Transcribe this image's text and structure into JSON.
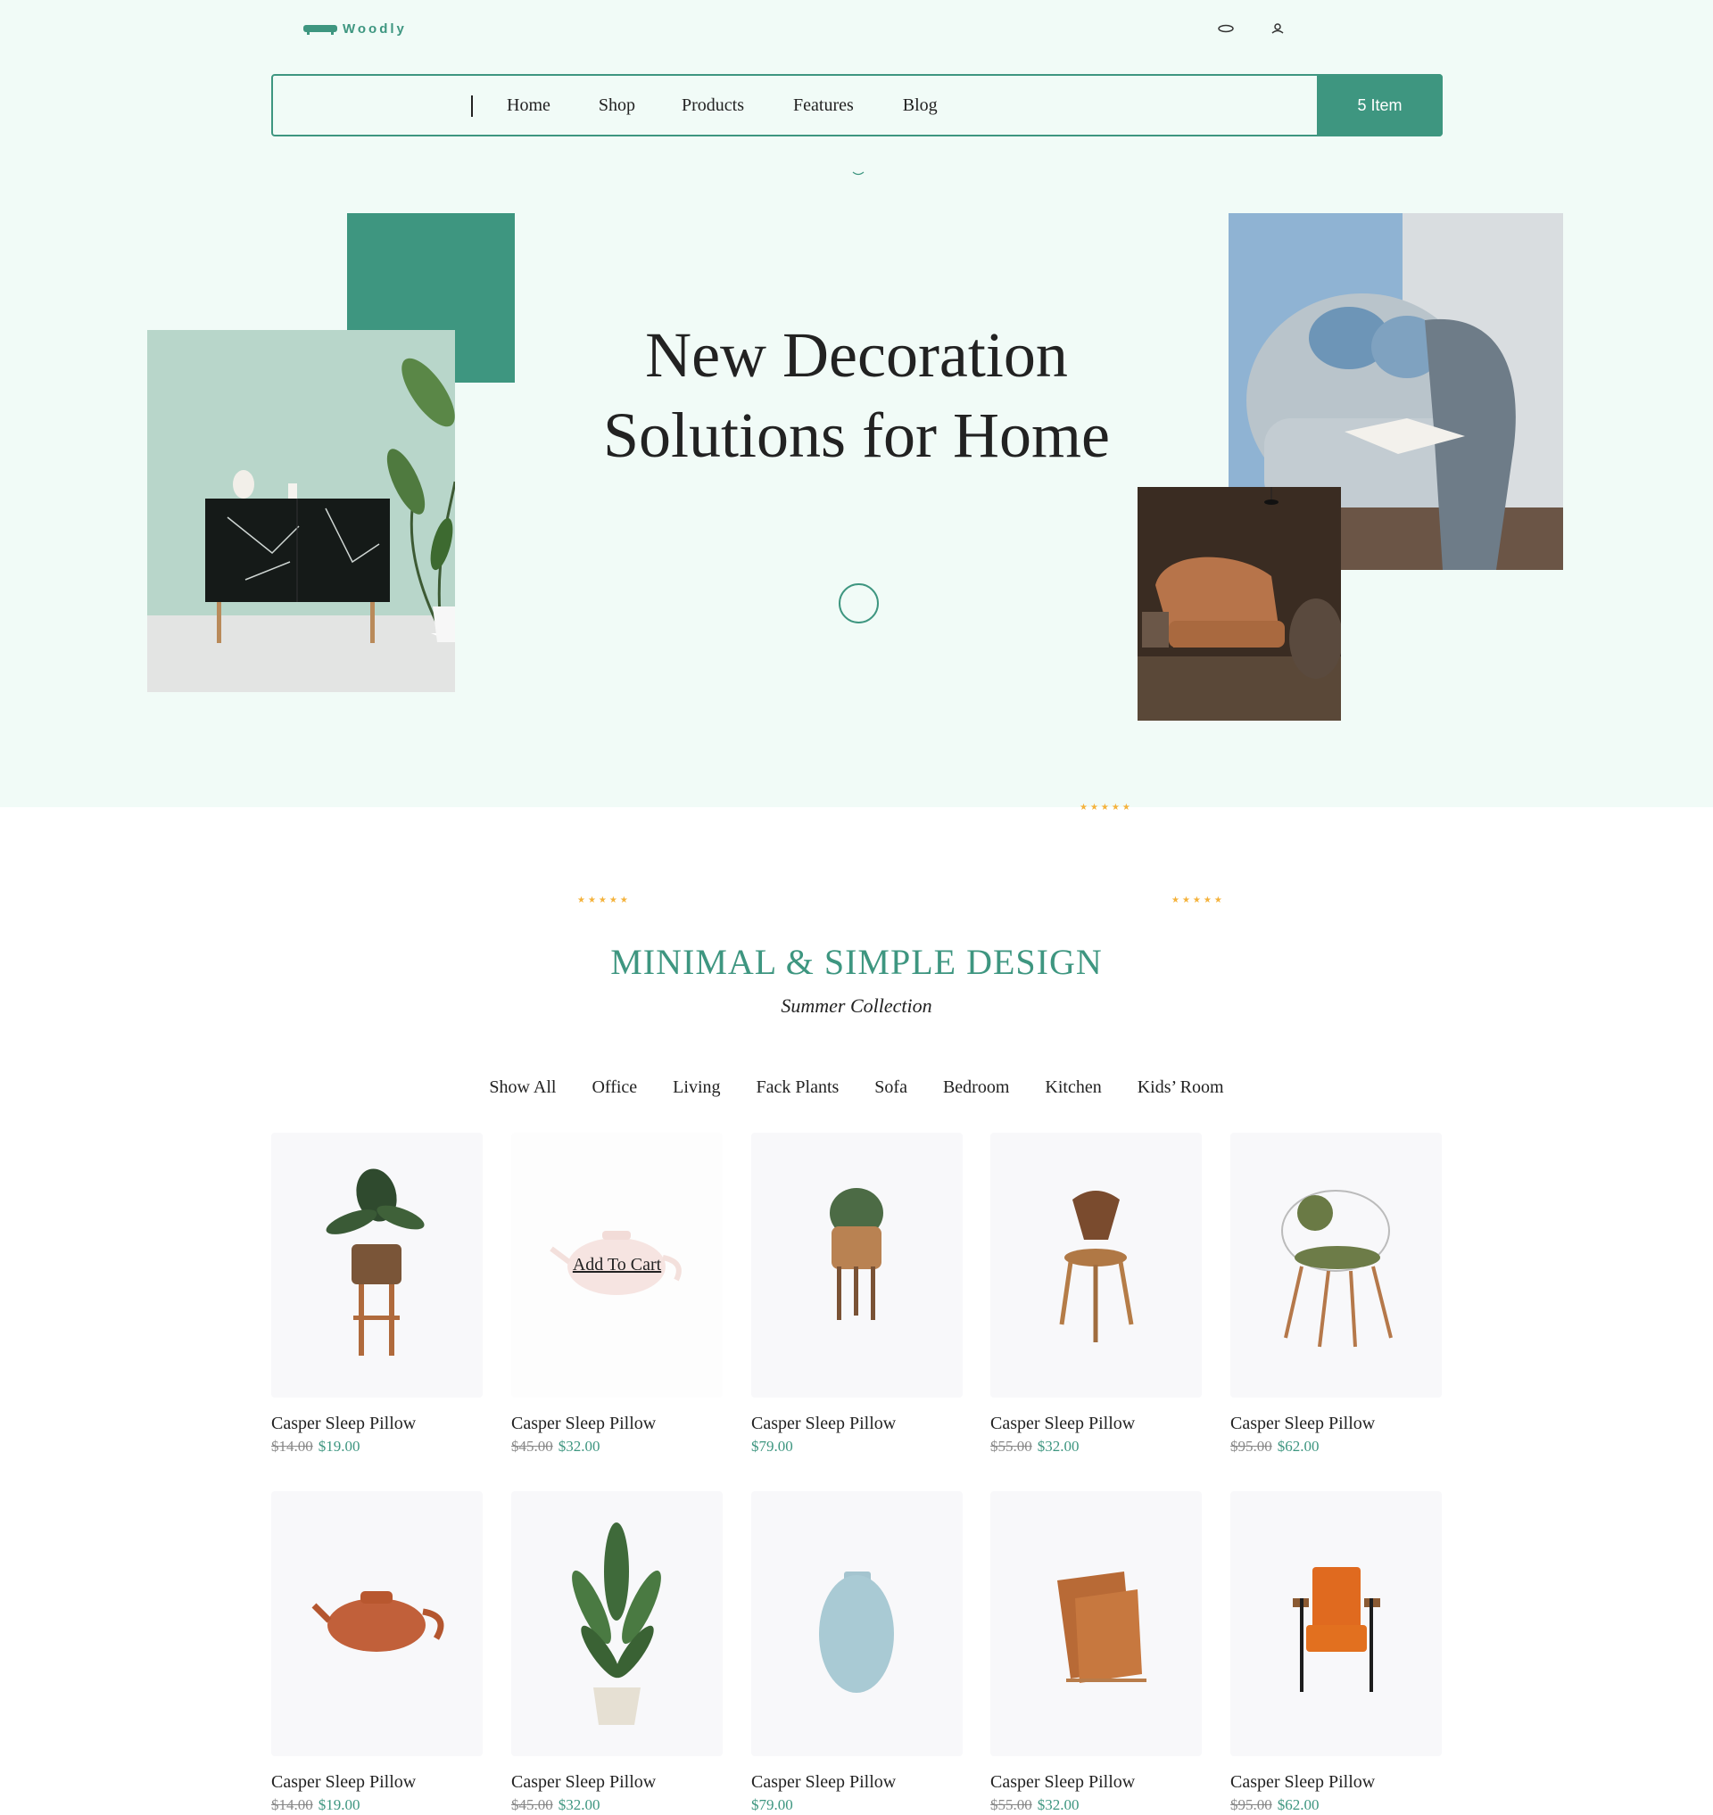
{
  "brand": {
    "name": "Woodly"
  },
  "icons": {
    "search": "search-icon",
    "user": "user-icon",
    "logo": "sofa-icon"
  },
  "nav": {
    "items": [
      "Home",
      "Shop",
      "Products",
      "Features",
      "Blog"
    ],
    "cart_label": "5 Item"
  },
  "hero": {
    "title_line1": "New Decoration",
    "title_line2": "Solutions for Home"
  },
  "section": {
    "title": "MINIMAL & SIMPLE DESIGN",
    "subtitle": "Summer Collection",
    "stars": "★★★★★"
  },
  "filters": [
    "Show All",
    "Office",
    "Living",
    "Fack Plants",
    "Sofa",
    "Bedroom",
    "Kitchen",
    "Kids’ Room"
  ],
  "products": [
    {
      "name": "Casper Sleep Pillow",
      "old_price": "$14.00",
      "price": "$19.00",
      "image": "plant-stand"
    },
    {
      "name": "Casper Sleep Pillow",
      "old_price": "$45.00",
      "price": "$32.00",
      "image": "teapot",
      "hover_label": "Add To Cart"
    },
    {
      "name": "Casper Sleep Pillow",
      "old_price": "",
      "price": "$79.00",
      "image": "cactus-basket"
    },
    {
      "name": "Casper Sleep Pillow",
      "old_price": "$55.00",
      "price": "$32.00",
      "image": "wooden-chair"
    },
    {
      "name": "Casper Sleep Pillow",
      "old_price": "$95.00",
      "price": "$62.00",
      "image": "wire-chair"
    },
    {
      "name": "Casper Sleep Pillow",
      "old_price": "$14.00",
      "price": "$19.00",
      "image": "teapot"
    },
    {
      "name": "Casper Sleep Pillow",
      "old_price": "$45.00",
      "price": "$32.00",
      "image": "potted-plant"
    },
    {
      "name": "Casper Sleep Pillow",
      "old_price": "",
      "price": "$79.00",
      "image": "vase"
    },
    {
      "name": "Casper Sleep Pillow",
      "old_price": "$55.00",
      "price": "$32.00",
      "image": "magazine-rack"
    },
    {
      "name": "Casper Sleep Pillow",
      "old_price": "$95.00",
      "price": "$62.00",
      "image": "orange-armchair"
    }
  ],
  "colors": {
    "accent": "#3e9680",
    "hero_bg": "#f1fbf7",
    "star": "#f4b23b",
    "card_bg": "#f8f8fa"
  }
}
